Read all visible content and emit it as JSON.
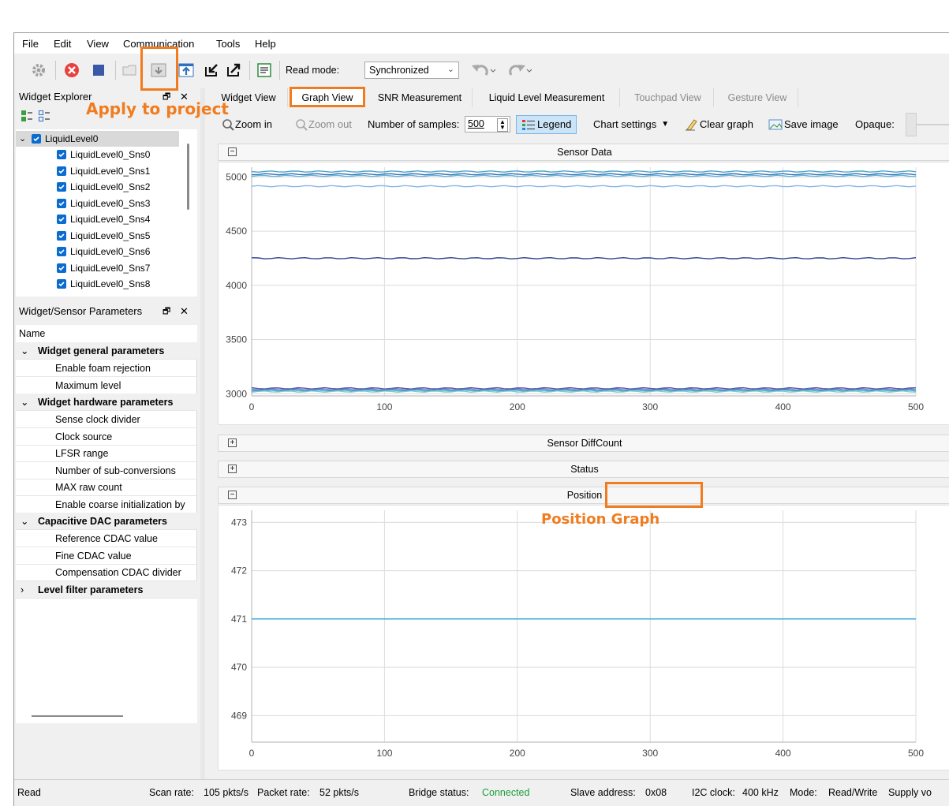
{
  "menu": [
    "File",
    "Edit",
    "View",
    "Communication",
    "Tools",
    "Help"
  ],
  "toolbar": {
    "read_mode_label": "Read mode:",
    "read_mode_value": "Synchronized",
    "icons": [
      "gear-icon",
      "stop-circle-icon",
      "stop-square-icon",
      "open-folder-icon",
      "apply-to-device-icon",
      "apply-to-project-icon",
      "import-icon",
      "export-icon",
      "log-icon",
      "undo-icon",
      "redo-icon"
    ]
  },
  "widget_explorer": {
    "title": "Widget Explorer",
    "root": "LiquidLevel0",
    "sensors": [
      "LiquidLevel0_Sns0",
      "LiquidLevel0_Sns1",
      "LiquidLevel0_Sns2",
      "LiquidLevel0_Sns3",
      "LiquidLevel0_Sns4",
      "LiquidLevel0_Sns5",
      "LiquidLevel0_Sns6",
      "LiquidLevel0_Sns7",
      "LiquidLevel0_Sns8"
    ]
  },
  "parameters": {
    "title": "Widget/Sensor Parameters",
    "name_header": "Name",
    "groups": [
      {
        "label": "Widget general parameters",
        "items": [
          "Enable foam rejection",
          "Maximum level"
        ]
      },
      {
        "label": "Widget hardware parameters",
        "items": [
          "Sense clock divider",
          "Clock source",
          "LFSR range",
          "Number of sub-conversions",
          "MAX raw count",
          "Enable coarse initialization by"
        ]
      },
      {
        "label": "Capacitive DAC parameters",
        "items": [
          "Reference CDAC value",
          "Fine CDAC value",
          "Compensation CDAC divider"
        ]
      },
      {
        "label": "Level filter parameters",
        "items": []
      }
    ]
  },
  "tabs": [
    {
      "label": "Widget View",
      "state": "normal"
    },
    {
      "label": "Graph View",
      "state": "active"
    },
    {
      "label": "SNR Measurement",
      "state": "normal"
    },
    {
      "label": "Liquid Level Measurement",
      "state": "normal"
    },
    {
      "label": "Touchpad View",
      "state": "disabled"
    },
    {
      "label": "Gesture View",
      "state": "disabled"
    }
  ],
  "graph_toolbar": {
    "zoom_in": "Zoom in",
    "zoom_out": "Zoom out",
    "samples_label": "Number of samples:",
    "samples_value": "500",
    "legend": "Legend",
    "chart_settings": "Chart settings",
    "clear_graph": "Clear graph",
    "save_image": "Save image",
    "opaque": "Opaque:"
  },
  "sections": {
    "sensor_data": "Sensor Data",
    "diffcount": "Sensor DiffCount",
    "status": "Status",
    "position": "Position"
  },
  "chart_data": [
    {
      "type": "line",
      "title": "Sensor Data",
      "x_ticks": [
        0,
        100,
        200,
        300,
        400,
        500
      ],
      "y_ticks": [
        3000,
        3500,
        4000,
        4500,
        5000
      ],
      "xlim": [
        0,
        500
      ],
      "ylim": [
        2980,
        5090
      ],
      "series": [
        {
          "values_constant": 5050,
          "color": "#4ca3c9"
        },
        {
          "values_constant": 5025,
          "color": "#2e6fb5"
        },
        {
          "values_constant": 5010,
          "color": "#6bb6d6"
        },
        {
          "values_constant": 4915,
          "color": "#8db8e8"
        },
        {
          "values_constant": 4250,
          "color": "#2d3f8f"
        },
        {
          "values_constant": 3050,
          "color": "#6a4fa3"
        },
        {
          "values_constant": 3040,
          "color": "#4f7fd0"
        },
        {
          "values_constant": 3030,
          "color": "#3aa0a8"
        },
        {
          "values_constant": 3020,
          "color": "#7fc9d9"
        }
      ]
    },
    {
      "type": "line",
      "title": "Position",
      "x_ticks": [
        0,
        100,
        200,
        300,
        400,
        500
      ],
      "y_ticks": [
        469,
        470,
        471,
        472,
        473
      ],
      "xlim": [
        0,
        500
      ],
      "ylim": [
        468.45,
        473.25
      ],
      "series": [
        {
          "values_constant": 471,
          "color": "#2aa7d8"
        }
      ]
    }
  ],
  "statusbar": {
    "state": "Read",
    "scan_rate_label": "Scan rate:",
    "scan_rate": "105 pkts/s",
    "packet_rate_label": "Packet rate:",
    "packet_rate": "52 pkts/s",
    "bridge_label": "Bridge status:",
    "bridge_value": "Connected",
    "slave_label": "Slave address:",
    "slave_value": "0x08",
    "i2c_label": "I2C clock:",
    "i2c_value": "400 kHz",
    "mode_label": "Mode:",
    "mode_value": "Read/Write",
    "supply_label": "Supply vo"
  },
  "annotations": {
    "apply_to_project": "Apply to project",
    "position_graph": "Position Graph"
  },
  "colors": {
    "accent": "#f07c1f",
    "checkbox": "#0a6cd1",
    "connected": "#1a9e3a"
  }
}
